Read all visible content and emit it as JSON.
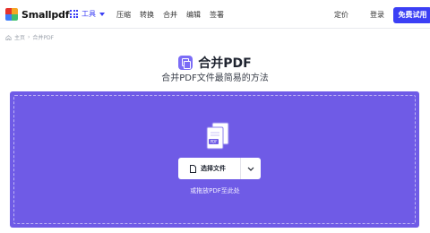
{
  "header": {
    "logo_text": "Smallpdf",
    "tools_label": "工具",
    "nav": [
      "压缩",
      "转换",
      "合并",
      "编辑",
      "签署"
    ],
    "pricing": "定价",
    "login": "登录",
    "trial": "免费试用"
  },
  "breadcrumb": {
    "home": "主页",
    "current": "合并PDF"
  },
  "main": {
    "title": "合并PDF",
    "subtitle": "合并PDF文件最简易的方法"
  },
  "dropzone": {
    "choose_label": "选择文件",
    "hint": "或拖放PDF至此处",
    "pdf_icon_text": "PDF"
  },
  "colors": {
    "accent": "#3b3ff5",
    "dropzone": "#6f5be6",
    "title_icon": "#7b6cf6"
  }
}
